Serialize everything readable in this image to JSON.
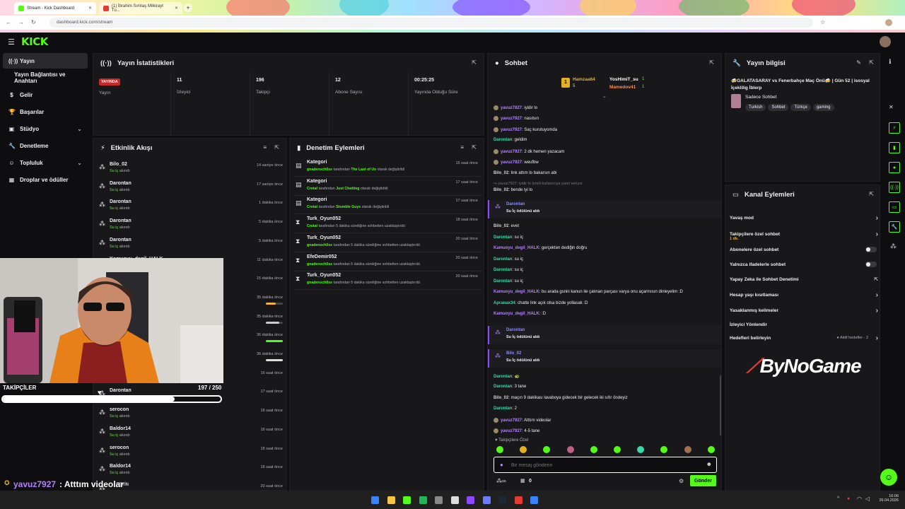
{
  "browser": {
    "tabs": [
      {
        "label": "Stream - Kick Dashboard"
      },
      {
        "label": "(1) İbrahim Sırlıtaş Milkirayt Tu..."
      }
    ],
    "url": "dashboard.kick.com/stream"
  },
  "brand": {
    "logo": "KICK",
    "accent": "#53fc18"
  },
  "sidebar": {
    "items": [
      {
        "label": "Yayın",
        "icon": "broadcast-icon"
      },
      {
        "label": "Yayın Bağlantısı ve Anahtarı",
        "icon": ""
      },
      {
        "label": "Gelir",
        "icon": "money-icon"
      },
      {
        "label": "Başarılar",
        "icon": "trophy-icon"
      },
      {
        "label": "Stüdyo",
        "icon": "studio-icon"
      },
      {
        "label": "Denetleme",
        "icon": "wrench-icon"
      },
      {
        "label": "Topluluk",
        "icon": "community-icon"
      },
      {
        "label": "Droplar ve ödüller",
        "icon": "drops-icon"
      }
    ]
  },
  "stats": {
    "title": "Yayın İstatistikleri",
    "live_badge": "YAYINDA",
    "items": [
      {
        "value": "",
        "label": "Yayın"
      },
      {
        "value": "11",
        "label": "İzleyici"
      },
      {
        "value": "196",
        "label": "Takipçi"
      },
      {
        "value": "12",
        "label": "Abone Sayısı"
      },
      {
        "value": "00:25:25",
        "label": "Yayında Olduğu Süre"
      }
    ]
  },
  "events": {
    "title": "Etkinlik Akışı",
    "items": [
      {
        "name": "Bilo_02",
        "action": "Su iç",
        "suffix": "akındı",
        "time": "14 saniye önce"
      },
      {
        "name": "Darontan",
        "action": "Su iç",
        "suffix": "akındı",
        "time": "17 saniye önce"
      },
      {
        "name": "Darontan",
        "action": "Su iç",
        "suffix": "akındı",
        "time": "1 dakika önce"
      },
      {
        "name": "Darontan",
        "action": "Su iç",
        "suffix": "akındı",
        "time": "5 dakika önce"
      },
      {
        "name": "Darontan",
        "action": "Su iç",
        "suffix": "akındı",
        "time": "5 dakika önce"
      },
      {
        "name": "Kamuoyu_degil_HALK",
        "action": "",
        "suffix": "",
        "time": "11 dakika önce"
      },
      {
        "name": "",
        "action": "",
        "suffix": "",
        "time": "15 dakika önce"
      },
      {
        "name": "",
        "action": "",
        "suffix": "",
        "time": "35 dakika önce",
        "bar": 0.6,
        "bar_color": "#f5b041"
      },
      {
        "name": "",
        "action": "",
        "suffix": "",
        "time": "35 dakika önce",
        "bar": 0.8,
        "bar_color": "#cccccc"
      },
      {
        "name": "",
        "action": "",
        "suffix": "",
        "time": "36 dakika önce",
        "bar": 1.0,
        "bar_color": "#53fc18"
      },
      {
        "name": "",
        "action": "",
        "suffix": "",
        "time": "36 dakika önce",
        "bar": 1.0,
        "bar_color": "#dddddd"
      },
      {
        "name": "",
        "action": "",
        "suffix": "",
        "time": "16 saat önce"
      },
      {
        "name": "Darontan",
        "action": "",
        "suffix": "",
        "time": "17 saat önce"
      },
      {
        "name": "serocon",
        "action": "Su iç",
        "suffix": "akındı",
        "time": "18 saat önce"
      },
      {
        "name": "Baldor14",
        "action": "Su iç",
        "suffix": "akındı",
        "time": "18 saat önce"
      },
      {
        "name": "serocon",
        "action": "Su iç",
        "suffix": "akındı",
        "time": "18 saat önce"
      },
      {
        "name": "Baldor14",
        "action": "Su iç",
        "suffix": "akındı",
        "time": "18 saat önce"
      },
      {
        "name": "",
        "action": "",
        "suffix": "",
        "time": "20 saat önce"
      }
    ]
  },
  "moderation": {
    "title": "Denetim Eylemleri",
    "items": [
      {
        "icon": "category-icon",
        "title": "Kategori",
        "actor": "gnadensch0ss",
        "text": "tarafından",
        "target": "The Last of Us",
        "text2": "olarak değiştirildi",
        "time": "15 saat önce"
      },
      {
        "icon": "category-icon",
        "title": "Kategori",
        "actor": "Crotal",
        "text": "tarafından",
        "target": "Just Chatting",
        "text2": "olarak değiştirildi",
        "time": "17 saat önce"
      },
      {
        "icon": "category-icon",
        "title": "Kategori",
        "actor": "Crotal",
        "text": "tarafından",
        "target": "Stumble Guys",
        "text2": "olarak değiştirildi",
        "time": "17 saat önce"
      },
      {
        "icon": "timeout-icon",
        "title": "Turk_Oyun052",
        "actor": "Crotal",
        "text": "tarafından 5 dakika süreliğine sohbetten uzaklaştırıldı",
        "target": "",
        "text2": "",
        "time": "18 saat önce"
      },
      {
        "icon": "timeout-icon",
        "title": "Turk_Oyun052",
        "actor": "gnadensch0ss",
        "text": "tarafından 5 dakika süreliğine sohbetten uzaklaştırıldı",
        "target": "",
        "text2": "",
        "time": "20 saat önce"
      },
      {
        "icon": "timeout-icon",
        "title": "EfeDemir052",
        "actor": "gnadensch0ss",
        "text": "tarafından 5 dakika süreliğine sohbetten uzaklaştırıldı",
        "target": "",
        "text2": "",
        "time": "20 saat önce"
      },
      {
        "icon": "timeout-icon",
        "title": "Turk_Oyun052",
        "actor": "gnadensch0ss",
        "text": "tarafından 5 dakika süreliğine sohbetten uzaklaştırıldı",
        "target": "",
        "text2": "",
        "time": "20 saat önce"
      }
    ]
  },
  "chat": {
    "title": "Sohbet",
    "leaders": [
      {
        "rank": "1",
        "name": "Hamzaa64",
        "count": "5"
      },
      {
        "rank": "",
        "name": "YosHimiT_su",
        "count": "1"
      },
      {
        "rank": "",
        "name": "Mamedov41",
        "count": "1"
      }
    ],
    "messages": [
      {
        "user": "yavuz7927",
        "color": "#b580ff",
        "text": ": iyidir lo",
        "badge": true
      },
      {
        "user": "yavuz7927",
        "color": "#b580ff",
        "text": ": nasılsın",
        "badge": true
      },
      {
        "user": "yavuz7927",
        "color": "#b580ff",
        "text": ": Saç kurutuyomda",
        "badge": true
      },
      {
        "user": "Darontan",
        "color": "#38d9a9",
        "text": ": geldim",
        "badge": false
      },
      {
        "user": "yavuz7927",
        "color": "#b580ff",
        "text": ": 2 dk hemen yazacam",
        "badge": true
      },
      {
        "user": "yavuz7927",
        "color": "#b580ff",
        "text": ": weufbw",
        "badge": true
      },
      {
        "user": "Bilo_02",
        "color": "#d0d0d0",
        "text": ": link attım lo bakarsın abi",
        "badge": false
      },
      {
        "user": "Bilo_02",
        "color": "#d0d0d0",
        "text": ": bende iyi lo",
        "badge": false,
        "reply": "↪ yavuz7927: iyidir lo Ismili kullanıcıya yanıt veriyor"
      },
      {
        "user": "Bilo_02",
        "color": "#d0d0d0",
        "text": ": evet",
        "badge": false
      },
      {
        "user": "Darontan",
        "color": "#38d9a9",
        "text": ": su iç",
        "badge": false
      },
      {
        "user": "Kamuoyu_degil_HALK",
        "color": "#b580ff",
        "text": ": gerçekten dediğin doğru",
        "badge": false
      },
      {
        "user": "Darontan",
        "color": "#38d9a9",
        "text": ": su iç",
        "badge": false
      },
      {
        "user": "Darontan",
        "color": "#38d9a9",
        "text": ": su iç",
        "badge": false
      },
      {
        "user": "Darontan",
        "color": "#38d9a9",
        "text": ": su iç",
        "badge": false
      },
      {
        "user": "Kamuoyu_degil_HALK",
        "color": "#b580ff",
        "text": ": bu arada gsnin kanun ile çalınan parçası varya onu açarmısın dinleyelim :D",
        "badge": false
      },
      {
        "user": "Apranax34",
        "color": "#38d9a9",
        "text": ": chatte link açık olsa bizde yollasak :D",
        "badge": false
      },
      {
        "user": "Kamuoyu_degil_HALK",
        "color": "#b580ff",
        "text": ": :D",
        "badge": false
      },
      {
        "user": "Darontan",
        "color": "#38d9a9",
        "text": ": 🐢",
        "badge": false
      },
      {
        "user": "Darontan",
        "color": "#38d9a9",
        "text": ": 3 tane",
        "badge": false
      },
      {
        "user": "Bilo_02",
        "color": "#d0d0d0",
        "text": ": maçın 9 dakikası lavaboya gidecek bir gelecek iki sıfır öndeyiz",
        "badge": false
      },
      {
        "user": "Darontan",
        "color": "#38d9a9",
        "text": ": 2",
        "badge": false
      },
      {
        "user": "yavuz7927",
        "color": "#b580ff",
        "text": ": Atttım videolar",
        "badge": true
      },
      {
        "user": "yavuz7927",
        "color": "#b580ff",
        "text": ": 4-5 tane",
        "badge": true
      }
    ],
    "rewards": [
      {
        "user": "Darontan",
        "text": "Su İç ödülünü aldı"
      },
      {
        "user": "Darontan",
        "text": "Su İç ödülünü aldı"
      },
      {
        "user": "Bilo_02",
        "text": "Su İç ödülünü aldı"
      }
    ],
    "followers_only": "♥ Takipçilere Özel",
    "input_placeholder": "Bir mesaj gönderin",
    "send_label": "Gönder",
    "points": "0"
  },
  "stream_info": {
    "title": "Yayın bilgisi",
    "stream_title": "🍻GALATASARAY vs Fenerbahçe Maç Önü🍻 | Gün 52 | isosyal İçeklilig İblerp",
    "category": "Sadece Sohbet",
    "tags": [
      "Turkish",
      "Sohbet",
      "Türkçe",
      "gaming"
    ]
  },
  "channel_actions": {
    "title": "Kanal Eylemleri",
    "items": [
      {
        "label": "Yavaş mod",
        "control": "arrow"
      },
      {
        "label": "Takipçilere özel sohbet",
        "sub": "1 dk.",
        "control": "arrow"
      },
      {
        "label": "Abonelere özel sohbet",
        "control": "toggle"
      },
      {
        "label": "Yalnızca ifadelerle sohbet",
        "control": "toggle"
      },
      {
        "label": "Yapay Zeka ile Sohbet Denetimi",
        "control": "external"
      },
      {
        "label": "Hesap yaşı kısıtlaması",
        "control": "arrow"
      },
      {
        "label": "Yasaklanmış kelimeler",
        "control": "arrow"
      },
      {
        "label": "İzleyici Yönlendir",
        "control": "none"
      },
      {
        "label": "Hedefleri belirleyin",
        "extra": "● Aktif hedefler - 2",
        "control": "arrow"
      }
    ]
  },
  "overlay": {
    "followers_label": "TAKİPÇİLER",
    "followers_count": "197 / 250",
    "followers_progress": 0.788,
    "chat_user": "yavuz7927",
    "chat_text": ": Atttım videolar",
    "watermark": "ByNoGame",
    "cut_text": "EYİN"
  },
  "taskbar": {
    "time": "16:06",
    "date": "26.04.2026"
  }
}
